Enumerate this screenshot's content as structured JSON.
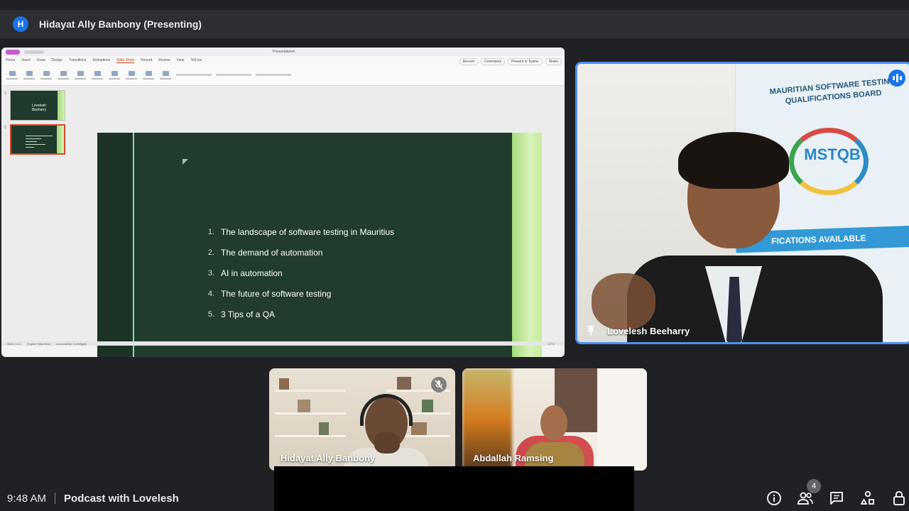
{
  "presenter": {
    "initial": "H",
    "label": "Hidayat Ally Banbony (Presenting)"
  },
  "powerpoint": {
    "doc_title": "Presentation4",
    "menu": [
      "Home",
      "Insert",
      "Draw",
      "Design",
      "Transitions",
      "Animations",
      "Slide Show",
      "Record",
      "Review",
      "View",
      "Tell me"
    ],
    "active_menu": "Slide Show",
    "actions": [
      "Record",
      "Comments",
      "Present in Teams",
      "Share"
    ],
    "thumbs": [
      {
        "num": "1",
        "title": "Lovelesh Beeharry"
      },
      {
        "num": "2",
        "title": ""
      }
    ],
    "status": [
      "Slide 2 of 2",
      "English (Mauritius)",
      "Accessibility: Investigate"
    ],
    "zoom": "107%"
  },
  "slide": {
    "agenda": [
      {
        "num": "1.",
        "text": "The landscape of software testing in Mauritius"
      },
      {
        "num": "2.",
        "text": "The demand of automation"
      },
      {
        "num": "3.",
        "text": "AI in automation"
      },
      {
        "num": "4.",
        "text": "The future of software testing"
      },
      {
        "num": "5.",
        "text": "3 Tips of a QA"
      }
    ]
  },
  "participants": {
    "main": {
      "name": "Lovelesh Beeharry",
      "banner_title": "MAURITIAN SOFTWARE TESTING QUALIFICATIONS BOARD",
      "banner_logo": "MSTQB",
      "banner_strip": "FICATIONS AVAILABLE"
    },
    "tile1": {
      "name": "Hidayat Ally Banbony"
    },
    "tile2": {
      "name": "Abdallah Ramsing"
    }
  },
  "bottom": {
    "time": "9:48 AM",
    "meeting_title": "Podcast with Lovelesh",
    "people_count": "4"
  },
  "colors": {
    "accent": "#1a73e8",
    "active_speaker_border": "#4f8ef7",
    "slide_bg": "#213b2c"
  },
  "icons": [
    "info-icon",
    "people-icon",
    "chat-icon",
    "activities-icon",
    "host-controls-icon",
    "pin-icon",
    "speaking-icon",
    "mic-off-icon"
  ]
}
